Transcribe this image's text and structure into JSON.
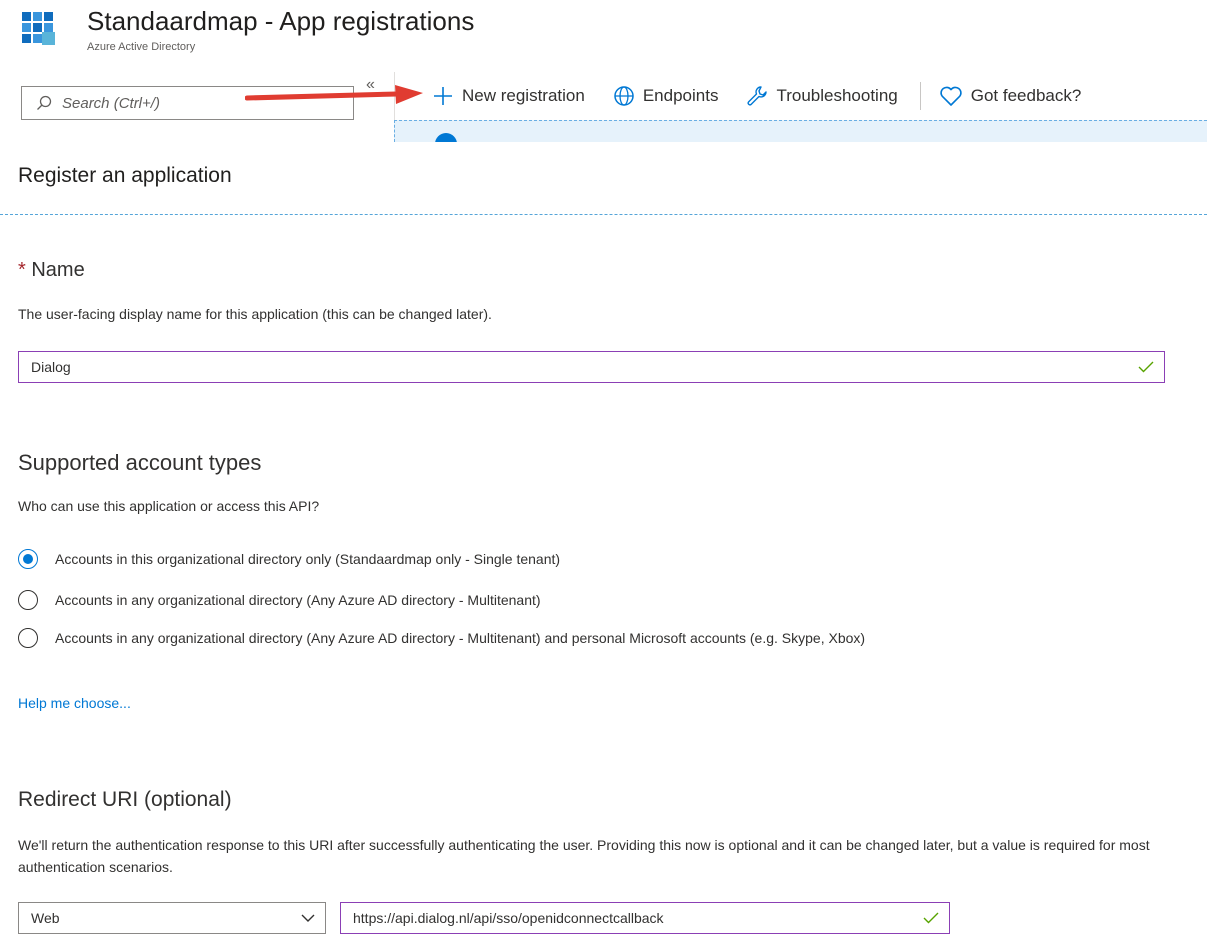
{
  "header": {
    "title": "Standaardmap - App registrations",
    "subtitle": "Azure Active Directory",
    "icon": "app-registrations-grid-icon"
  },
  "search": {
    "placeholder": "Search (Ctrl+/)"
  },
  "collapse": {
    "label": "«"
  },
  "toolbar": {
    "new_registration": "New registration",
    "endpoints": "Endpoints",
    "troubleshooting": "Troubleshooting",
    "feedback": "Got feedback?"
  },
  "blade": {
    "title": "Register an application"
  },
  "name_section": {
    "required_marker": "*",
    "title": "Name",
    "description": "The user-facing display name for this application (this can be changed later).",
    "value": "Dialog"
  },
  "account_section": {
    "title": "Supported account types",
    "question": "Who can use this application or access this API?",
    "options": [
      {
        "label": "Accounts in this organizational directory only (Standaardmap only - Single tenant)",
        "selected": true
      },
      {
        "label": "Accounts in any organizational directory (Any Azure AD directory - Multitenant)",
        "selected": false
      },
      {
        "label": "Accounts in any organizational directory (Any Azure AD directory - Multitenant) and personal Microsoft accounts (e.g. Skype, Xbox)",
        "selected": false
      }
    ],
    "help_link": "Help me choose..."
  },
  "redirect_section": {
    "title": "Redirect URI (optional)",
    "description": "We'll return the authentication response to this URI after successfully authenticating the user. Providing this now is optional and it can be changed later, but a value is required for most authentication scenarios.",
    "platform": "Web",
    "uri": "https://api.dialog.nl/api/sso/openidconnectcallback"
  },
  "colors": {
    "accent": "#0078d4",
    "valid_check": "#57a300",
    "focus_border": "#8b3fb5",
    "annotation_arrow": "#e03c31",
    "required": "#a4262c"
  }
}
